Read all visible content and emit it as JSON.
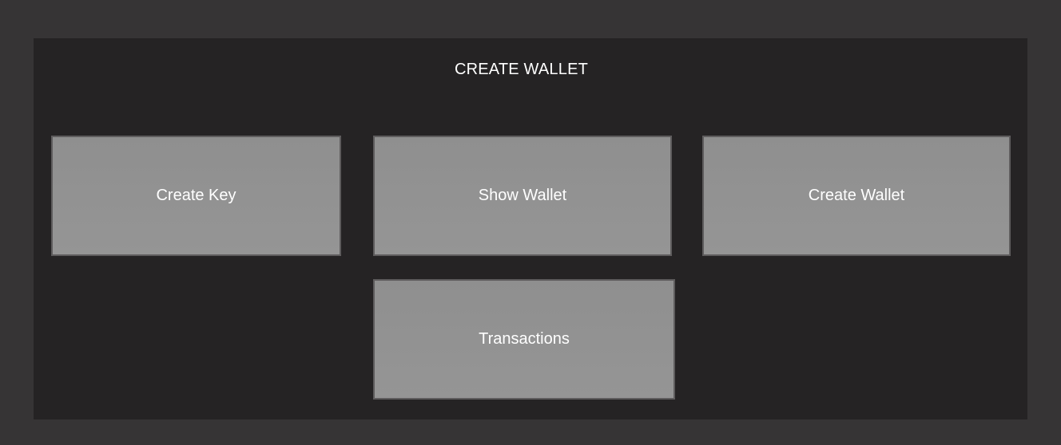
{
  "header": {
    "title": "CREATE WALLET"
  },
  "buttons": {
    "create_key": "Create Key",
    "show_wallet": "Show Wallet",
    "create_wallet": "Create Wallet",
    "transactions": "Transactions"
  },
  "colors": {
    "outer_background": "#363435",
    "panel_background": "#252324",
    "button_fill": "#929292",
    "button_border": "#5e5c5d",
    "text": "#ffffff"
  }
}
